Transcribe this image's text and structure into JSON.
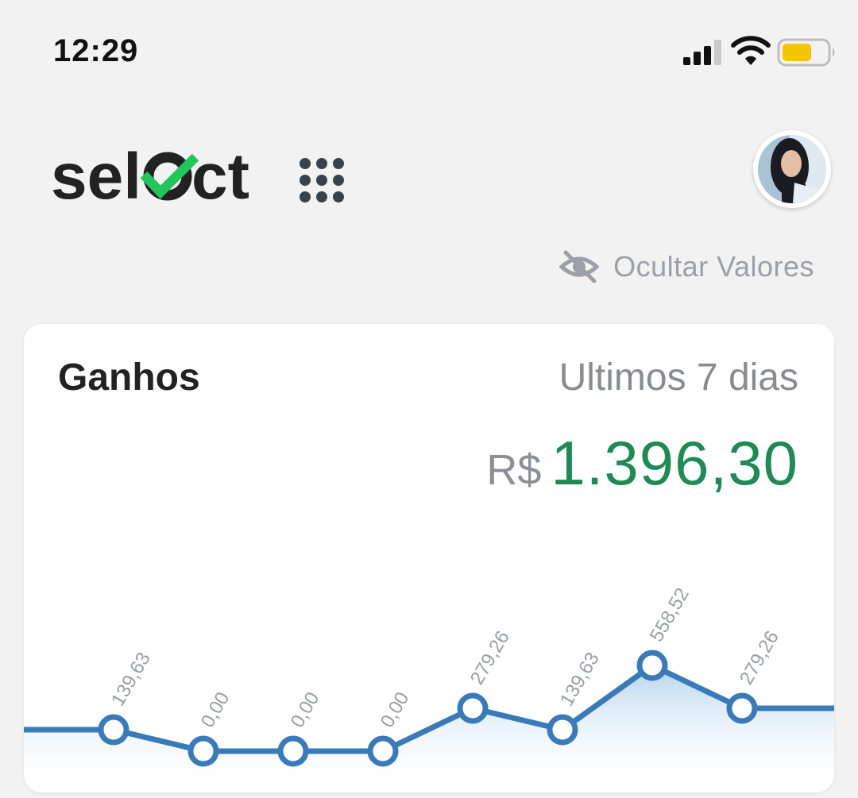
{
  "status_bar": {
    "time": "12:29",
    "battery_color": "#f5c400"
  },
  "header": {
    "logo_text_left": "sel",
    "logo_text_right": "ct",
    "logo_accent_color": "#22c55e",
    "apps_icon": "grid-dots-icon",
    "avatar": "user-avatar"
  },
  "privacy": {
    "hide_values_label": "Ocultar Valores",
    "icon": "eye-off-icon"
  },
  "earnings_card": {
    "title": "Ganhos",
    "period": "Ultimos 7 dias",
    "currency": "R$",
    "total": "1.396,30",
    "total_color": "#1f8a55"
  },
  "chart_data": {
    "type": "area",
    "title": "",
    "xlabel": "",
    "ylabel": "",
    "ylim": [
      0,
      558.52
    ],
    "grid": false,
    "line_color": "#3a7ab8",
    "values": [
      139.63,
      0.0,
      0.0,
      0.0,
      279.26,
      139.63,
      558.52,
      279.26
    ],
    "labels": [
      "139,63",
      "0,00",
      "0,00",
      "0,00",
      "279,26",
      "139,63",
      "558,52",
      "279,26"
    ]
  }
}
